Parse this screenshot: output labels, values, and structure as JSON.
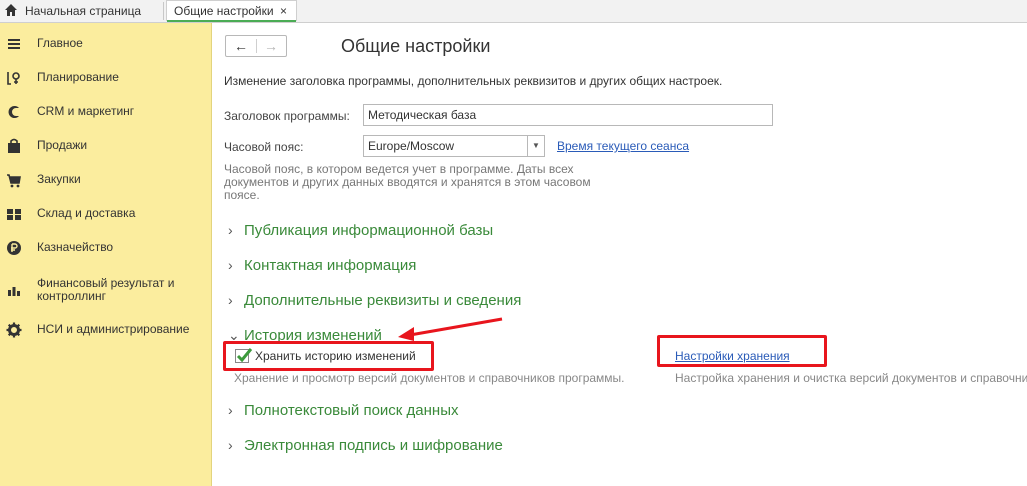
{
  "tabs": {
    "home_label": "Начальная страница",
    "active_label": "Общие настройки",
    "close_glyph": "×"
  },
  "sidebar": {
    "items": [
      {
        "label": "Главное",
        "icon": "menu-icon"
      },
      {
        "label": "Планирование",
        "icon": "planning-icon"
      },
      {
        "label": "CRM и маркетинг",
        "icon": "crm-icon"
      },
      {
        "label": "Продажи",
        "icon": "bag-icon"
      },
      {
        "label": "Закупки",
        "icon": "cart-icon"
      },
      {
        "label": "Склад и доставка",
        "icon": "warehouse-icon"
      },
      {
        "label": "Казначейство",
        "icon": "ruble-icon"
      },
      {
        "label": "Финансовый результат и контроллинг",
        "icon": "chart-icon"
      },
      {
        "label": "НСИ и администрирование",
        "icon": "gear-icon"
      }
    ]
  },
  "main": {
    "nav_back": "←",
    "nav_forward": "→",
    "title": "Общие настройки",
    "description": "Изменение заголовка программы, дополнительных реквизитов и других общих настроек.",
    "program_title_label": "Заголовок программы:",
    "program_title_value": "Методическая база",
    "timezone_label": "Часовой пояс:",
    "timezone_value": "Europe/Moscow",
    "session_time_link": "Время текущего сеанса",
    "timezone_hint": "Часовой пояс, в котором ведется учет в программе. Даты всех документов и других данных вводятся и хранятся в этом часовом поясе.",
    "sections": [
      {
        "label": "Публикация информационной базы",
        "expanded": false
      },
      {
        "label": "Контактная информация",
        "expanded": false
      },
      {
        "label": "Дополнительные реквизиты и сведения",
        "expanded": false
      },
      {
        "label": "История изменений",
        "expanded": true
      },
      {
        "label": "Полнотекстовый поиск данных",
        "expanded": false
      },
      {
        "label": "Электронная подпись и шифрование",
        "expanded": false
      }
    ],
    "history": {
      "checkbox_label": "Хранить историю изменений",
      "checkbox_checked": true,
      "checkbox_descr": "Хранение и просмотр версий документов и справочников программы.",
      "storage_link": "Настройки хранения",
      "storage_descr": "Настройка хранения и очистка версий документов и справочников программы."
    }
  },
  "colors": {
    "sidebar_bg": "#fbed9e",
    "section_green": "#3a8a3a",
    "highlight_red": "#e8151d",
    "link_blue": "#2a5bb8",
    "checkmark_green": "#3c9a3c"
  }
}
